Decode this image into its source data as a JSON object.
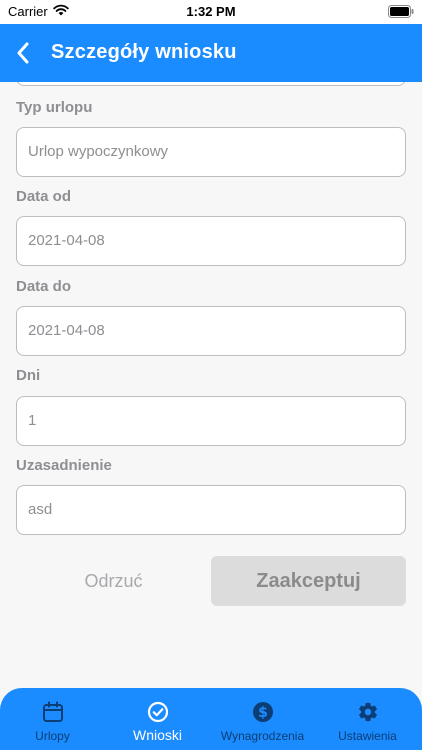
{
  "status_bar": {
    "carrier": "Carrier",
    "time": "1:32 PM"
  },
  "header": {
    "title": "Szczegóły wniosku"
  },
  "form": {
    "leave_type_label": "Typ urlopu",
    "leave_type_value": "Urlop wypoczynkowy",
    "date_from_label": "Data od",
    "date_from_value": "2021-04-08",
    "date_to_label": "Data do",
    "date_to_value": "2021-04-08",
    "days_label": "Dni",
    "days_value": "1",
    "justification_label": "Uzasadnienie",
    "justification_value": "asd"
  },
  "actions": {
    "reject_label": "Odrzuć",
    "accept_label": "Zaakceptuj"
  },
  "tab_bar": {
    "items": [
      {
        "label": "Urlopy",
        "icon": "calendar-icon"
      },
      {
        "label": "Wnioski",
        "icon": "check-circle-icon"
      },
      {
        "label": "Wynagrodzenia",
        "icon": "dollar-icon"
      },
      {
        "label": "Ustawienia",
        "icon": "gear-icon"
      }
    ],
    "active_index": 1
  },
  "colors": {
    "primary": "#1a8cff",
    "tab_inactive": "#0c3d75",
    "background": "#f7f7f7"
  }
}
